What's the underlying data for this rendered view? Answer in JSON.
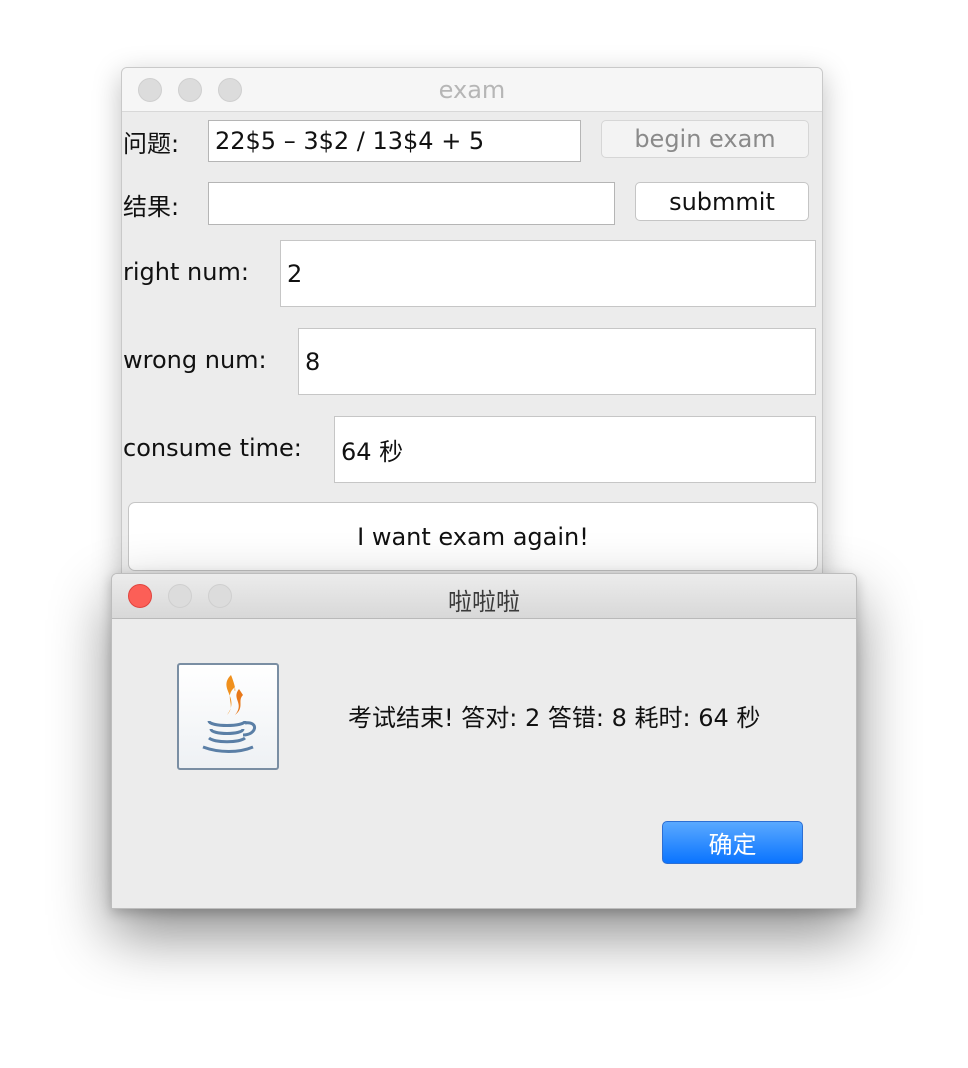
{
  "exam_window": {
    "title": "exam",
    "question_label": "问题:",
    "question_value": "22$5 – 3$2 / 13$4 + 5",
    "begin_button": "begin exam",
    "result_label": "结果:",
    "result_value": "",
    "submit_button": "submmit",
    "right_label": "right num:",
    "right_value": "2",
    "wrong_label": "wrong num:",
    "wrong_value": "8",
    "time_label": "consume time:",
    "time_value": "64 秒",
    "again_button": "I want exam again!"
  },
  "dialog": {
    "title": "啦啦啦",
    "message": "考试结束! 答对: 2 答错: 8 耗时:  64 秒",
    "ok_button": "确定",
    "icon": "java-coffee-icon"
  },
  "colors": {
    "close_red": "#fc5f57",
    "ok_blue": "#1a80ff"
  }
}
